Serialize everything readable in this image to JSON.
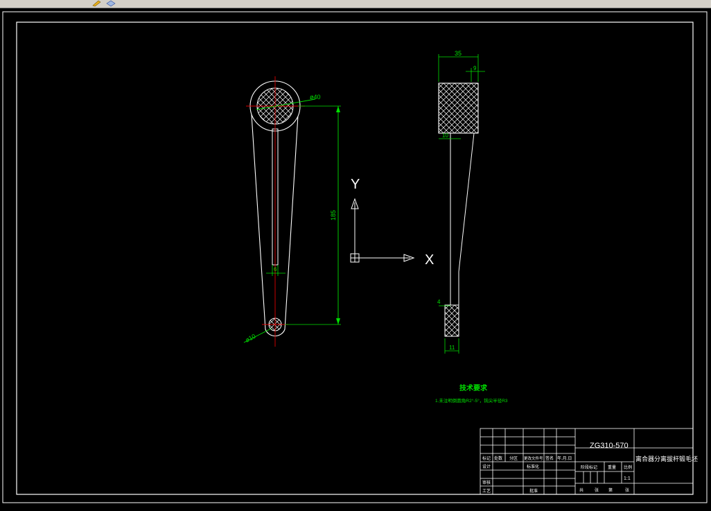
{
  "toolbar": {
    "icons": [
      "pencil-icon",
      "layers-icon"
    ]
  },
  "drawing": {
    "dimensions": {
      "top_diameter": "ø40",
      "bottom_diameter": "ø10",
      "center_distance": "185",
      "slot_width": "6",
      "side_width": "35",
      "side_offset": "9",
      "neck_width": "10",
      "tip_step": "4",
      "tip_width": "11"
    },
    "ucs": {
      "y_label": "Y",
      "x_label": "X"
    },
    "notes": {
      "title": "技术要求",
      "line1": "1.未注明倒圆角R2°-5°，钝尖半径R3"
    }
  },
  "title_block": {
    "drawing_no": "ZG310-570",
    "part_name": "离合器分离拔杆锻毛坯",
    "scale": "1:1",
    "header_cells": [
      "标记",
      "处数",
      "分区",
      "更改文件号",
      "签名",
      "年.月.日"
    ],
    "role_designer": "设计",
    "role_standard": "标准化",
    "role_checker": "审核",
    "role_process": "工艺",
    "role_approve": "批准",
    "stage_label": "阶段标记",
    "weight_label": "重量",
    "scale_label": "比例",
    "sheet_total": "共",
    "sheet_unit": "张",
    "sheet_no": "第",
    "sheet_unit2": "张"
  }
}
